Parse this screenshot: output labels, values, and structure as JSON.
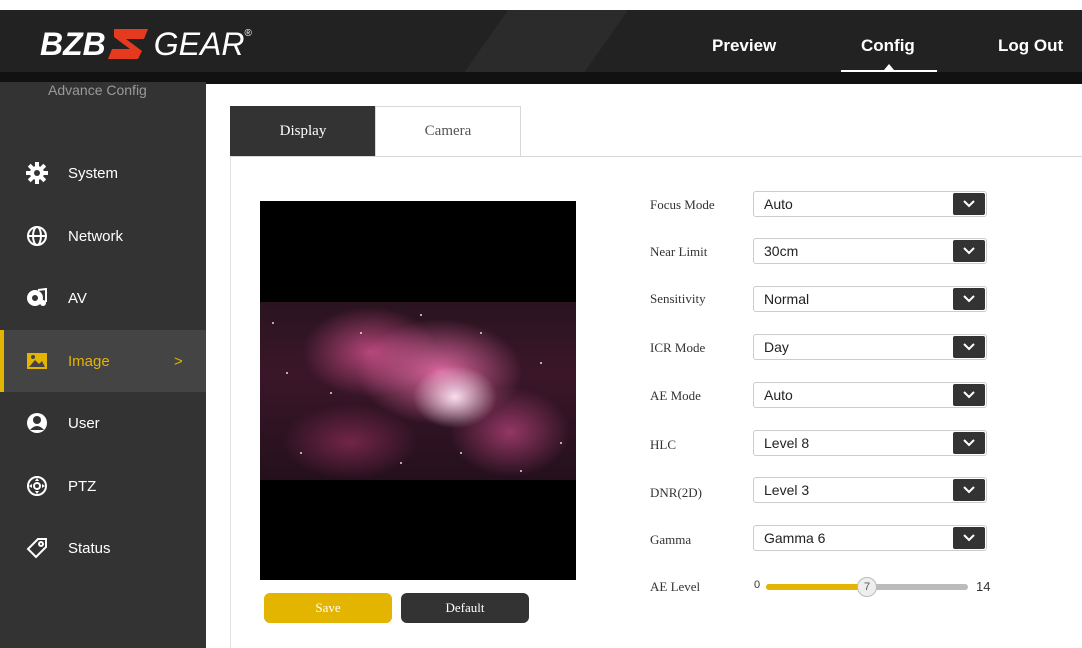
{
  "header": {
    "logo": {
      "left": "BZB",
      "right": "GEAR",
      "reg": "®"
    },
    "nav": {
      "preview": "Preview",
      "config": "Config",
      "logout": "Log Out"
    }
  },
  "sidebar": {
    "title": "Advance Config",
    "items": [
      {
        "label": "System",
        "icon": "gear-icon"
      },
      {
        "label": "Network",
        "icon": "globe-icon"
      },
      {
        "label": "AV",
        "icon": "music-icon"
      },
      {
        "label": "Image",
        "icon": "image-icon",
        "active": true,
        "chevron": ">"
      },
      {
        "label": "User",
        "icon": "user-icon"
      },
      {
        "label": "PTZ",
        "icon": "ptz-icon"
      },
      {
        "label": "Status",
        "icon": "tag-icon"
      }
    ]
  },
  "tabs": {
    "display": "Display",
    "camera": "Camera",
    "active": "Display"
  },
  "buttons": {
    "save": "Save",
    "default": "Default"
  },
  "form": {
    "fields": [
      {
        "label": "Focus Mode",
        "value": "Auto"
      },
      {
        "label": "Near Limit",
        "value": "30cm"
      },
      {
        "label": "Sensitivity",
        "value": "Normal"
      },
      {
        "label": "ICR Mode",
        "value": "Day"
      },
      {
        "label": "AE Mode",
        "value": "Auto"
      },
      {
        "label": "HLC",
        "value": "Level 8"
      },
      {
        "label": "DNR(2D)",
        "value": "Level 3"
      },
      {
        "label": "Gamma",
        "value": "Gamma 6"
      }
    ],
    "ae_level": {
      "label": "AE Level",
      "min": "0",
      "max": "14",
      "value": "7"
    }
  },
  "colors": {
    "accent": "#e3b400",
    "dark": "#333333",
    "header": "#222222"
  }
}
